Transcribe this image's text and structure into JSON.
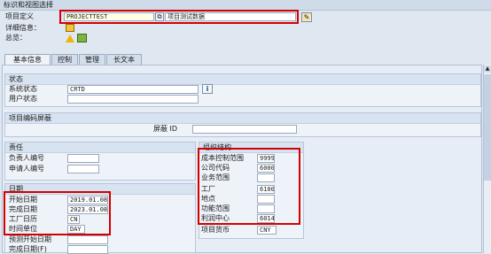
{
  "header": {
    "section_title": "标识和视图选择",
    "project_def_label": "项目定义",
    "project_def_value": "PROJECTTEST",
    "project_desc_value": "项目测试数据",
    "detail_info_label": "详细信息：",
    "overview_label": "总览："
  },
  "tabs": [
    "基本信息",
    "控制",
    "管理",
    "长文本"
  ],
  "status": {
    "title": "状态",
    "system_status_label": "系统状态",
    "system_status_value": "CRTD",
    "user_status_label": "用户状态",
    "user_status_value": ""
  },
  "mask": {
    "title": "项目编码屏蔽",
    "mask_id_label": "屏蔽 ID",
    "mask_id_value": ""
  },
  "responsibility": {
    "title": "责任",
    "responsible_label": "负责人编号",
    "responsible_value": "",
    "applicant_label": "申请人编号",
    "applicant_value": ""
  },
  "dates": {
    "title": "日期",
    "start_label": "开始日期",
    "start_value": "2019.01.08",
    "finish_label": "完成日期",
    "finish_value": "2023.01.08",
    "calendar_label": "工厂日历",
    "calendar_value": "CN",
    "unit_label": "时间单位",
    "unit_value": "DAY",
    "fc_start_label": "预测开始日期",
    "fc_start_value": "",
    "fc_finish_label": "完成日期(F)",
    "fc_finish_value": ""
  },
  "org": {
    "title": "组织结构",
    "controlling_area_label": "成本控制范围",
    "controlling_area_value": "9999",
    "company_code_label": "公司代码",
    "company_code_value": "6000",
    "business_area_label": "业务范围",
    "business_area_value": "",
    "plant_label": "工厂",
    "plant_value": "6100",
    "location_label": "地点",
    "location_value": "",
    "functional_area_label": "功能范围",
    "functional_area_value": "",
    "profit_center_label": "利润中心",
    "profit_center_value": "6014",
    "currency_label": "项目货币",
    "currency_value": "CNY"
  },
  "colors": {
    "highlight": "#d40000",
    "background": "#dfe7f1",
    "group_header": "#d7e3f0"
  }
}
